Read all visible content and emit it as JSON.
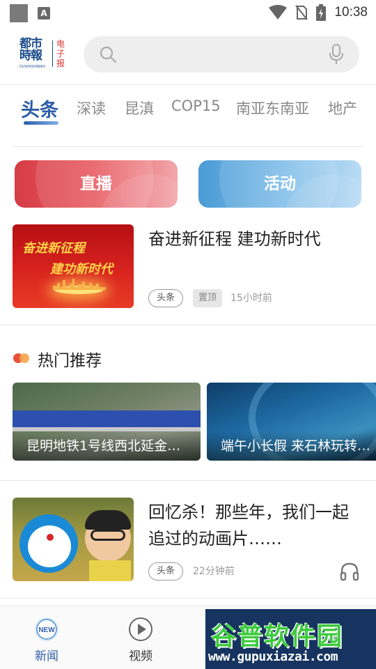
{
  "status_bar": {
    "time": "10:38",
    "icons": [
      "notification-square-icon",
      "a-notification-icon",
      "wifi-icon",
      "no-sim-icon",
      "battery-charging-icon"
    ]
  },
  "header": {
    "logo": {
      "name_text": "都市時報",
      "sub_text": "电子报",
      "en_text": "DUSHISHIBAO"
    },
    "search": {
      "placeholder": ""
    }
  },
  "tabs": [
    {
      "label": "头条",
      "active": true
    },
    {
      "label": "深读"
    },
    {
      "label": "昆滇"
    },
    {
      "label": "COP15"
    },
    {
      "label": "南亚东南亚"
    },
    {
      "label": "地产"
    }
  ],
  "actions": {
    "live_label": "直播",
    "event_label": "活动"
  },
  "news": [
    {
      "title": "奋进新征程  建功新时代",
      "tag": "头条",
      "pinned_label": "置顶",
      "time": "15小时前",
      "thumb_line1": "奋进新征程",
      "thumb_line2": "建功新时代"
    },
    {
      "title": "回忆杀！那些年，我们一起追过的动画片……",
      "tag": "头条",
      "time": "22分钟前",
      "audio_icon": "headphone-icon"
    }
  ],
  "hot": {
    "title": "热门推荐",
    "cards": [
      {
        "caption": "昆明地铁1号线西北延金…"
      },
      {
        "caption": "端午小长假 来石林玩转…"
      }
    ]
  },
  "bottom_nav": [
    {
      "label": "新闻",
      "icon": "new-badge-icon",
      "badge": "NEW",
      "active": true
    },
    {
      "label": "视频",
      "icon": "play-circle-icon"
    }
  ],
  "watermark": {
    "title": "谷普软件园",
    "url": "www.gupuxiazai.com"
  },
  "colors": {
    "brand_blue": "#2d5ea8",
    "live_red": "#d63c46",
    "event_blue": "#4a9bd6"
  }
}
